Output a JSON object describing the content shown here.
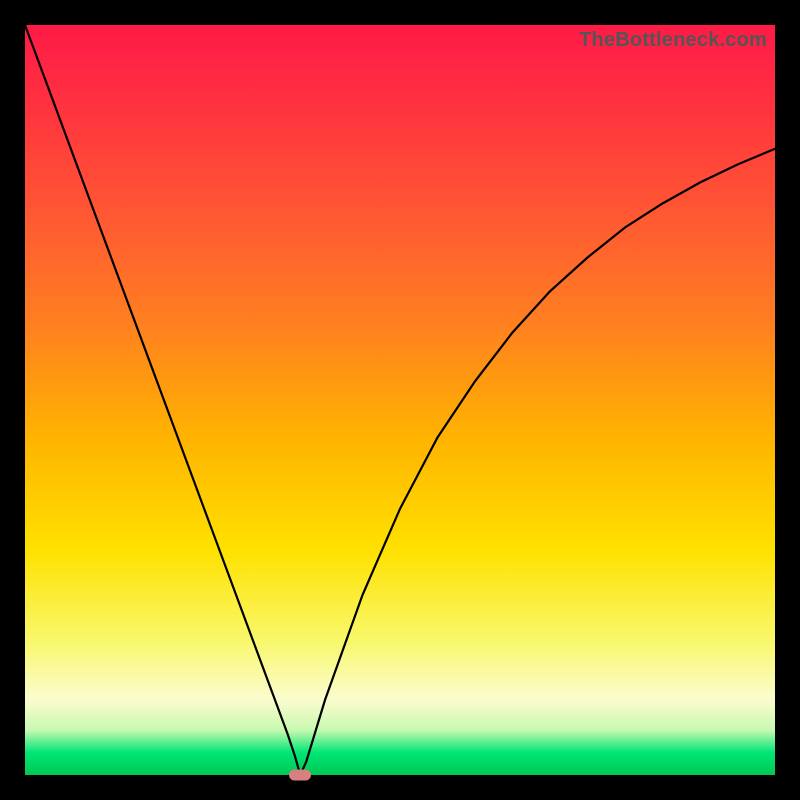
{
  "watermark": {
    "text": "TheBottleneck.com"
  },
  "chart_data": {
    "type": "line",
    "title": "",
    "xlabel": "",
    "ylabel": "",
    "xlim": [
      0,
      100
    ],
    "ylim": [
      0,
      100
    ],
    "grid": false,
    "legend": false,
    "series": [
      {
        "name": "bottleneck-curve",
        "x": [
          0,
          5,
          10,
          15,
          20,
          25,
          30,
          33,
          35,
          36,
          36.7,
          37.5,
          40,
          45,
          50,
          55,
          60,
          65,
          70,
          75,
          80,
          85,
          90,
          95,
          100
        ],
        "y": [
          100,
          86.5,
          73,
          59.5,
          46,
          32.5,
          19,
          10.9,
          5.5,
          2.5,
          0,
          1.8,
          10,
          24,
          35.5,
          45,
          52.5,
          59,
          64.5,
          69,
          73,
          76.2,
          79,
          81.4,
          83.5
        ]
      }
    ],
    "marker": {
      "x": 36.7,
      "y": 0,
      "color": "#d88080"
    },
    "background_gradient": {
      "top": "#ff1a47",
      "mid": "#ffe100",
      "bottom": "#00c853"
    }
  }
}
